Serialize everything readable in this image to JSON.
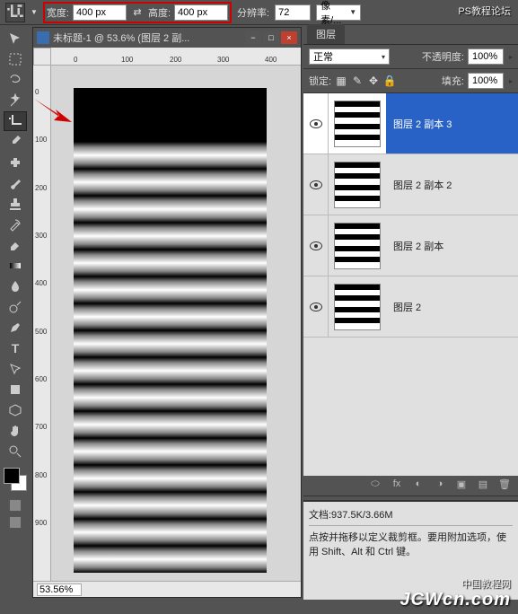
{
  "options_bar": {
    "width_label": "宽度:",
    "width_value": "400 px",
    "height_label": "高度:",
    "height_value": "400 px",
    "resolution_label": "分辨率:",
    "resolution_value": "72",
    "units": "像素/..."
  },
  "document": {
    "title": "未标题-1 @ 53.6% (图层 2 副...",
    "zoom": "53.56%",
    "ruler_h": [
      "0",
      "100",
      "200",
      "300",
      "400"
    ],
    "ruler_v": [
      "0",
      "100",
      "200",
      "300",
      "400",
      "500",
      "600",
      "700",
      "800",
      "900"
    ]
  },
  "layers_panel": {
    "tab": "图层",
    "blend_mode": "正常",
    "opacity_label": "不透明度:",
    "opacity_value": "100%",
    "lock_label": "锁定:",
    "fill_label": "填充:",
    "fill_value": "100%",
    "layers": [
      {
        "name": "图层 2 副本 3",
        "visible": true,
        "selected": true
      },
      {
        "name": "图层 2 副本 2",
        "visible": true,
        "selected": false
      },
      {
        "name": "图层 2 副本",
        "visible": true,
        "selected": false
      },
      {
        "name": "图层 2",
        "visible": true,
        "selected": false
      }
    ]
  },
  "info_panel": {
    "doc_size": "文档:937.5K/3.66M",
    "hint": "点按并拖移以定义裁剪框。要用附加选项，使用 Shift、Alt 和 Ctrl 键。"
  },
  "watermarks": {
    "top": "PS教程论坛",
    "mid": "中国教程网",
    "bottom": "JCWcn.com"
  }
}
